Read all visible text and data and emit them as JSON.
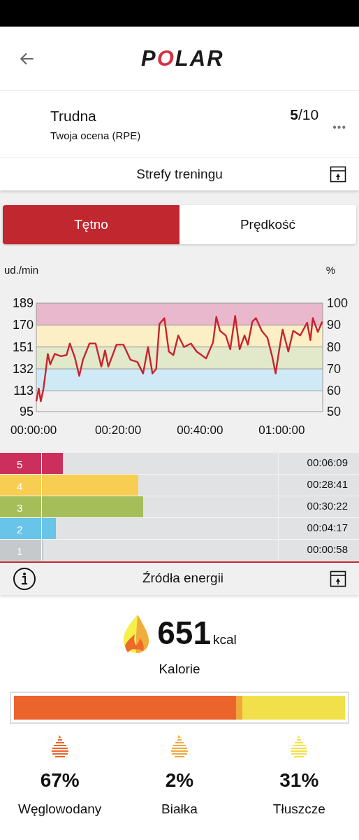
{
  "header": {
    "logo": "POLAR"
  },
  "rpe": {
    "title": "Trudna",
    "subtitle": "Twoja ocena (RPE)",
    "score": "5",
    "max": "/10",
    "menu": "•••"
  },
  "zones_section": {
    "title": "Strefy treningu",
    "tabs": [
      {
        "label": "Tętno",
        "selected": true
      },
      {
        "label": "Prędkość",
        "selected": false
      }
    ],
    "left_unit": "ud./min",
    "right_unit": "%",
    "right_ticks": [
      "100",
      "90",
      "80",
      "70",
      "60",
      "50"
    ],
    "chart_data": {
      "type": "line",
      "x": [
        0,
        0.6,
        1.1,
        1.7,
        2.3,
        2.8,
        3.4,
        4.5,
        6,
        7.4,
        8.2,
        9.4,
        10.5,
        11.4,
        13,
        14.5,
        15.9,
        16.8,
        17.6,
        19.6,
        21.3,
        23,
        24.7,
        26.1,
        27.3,
        28.4,
        29.3,
        30.1,
        31.3,
        32.4,
        33.5,
        34.7,
        36.1,
        37.8,
        39.2,
        41.5,
        43.2,
        44,
        44.9,
        46.3,
        47.4,
        48.6,
        49.7,
        50.9,
        51.7,
        52.8,
        53.7,
        55.1,
        56.5,
        57.7,
        58.5,
        59.4,
        60.2,
        61.6,
        62.8,
        64.5,
        66.2,
        67,
        67.6,
        68.8,
        69.9
      ],
      "series": [
        {
          "color": "#c8232e",
          "values": [
            104,
            115,
            104,
            114,
            130,
            145,
            136,
            145,
            143,
            144,
            154,
            142,
            126,
            140,
            154,
            154,
            134,
            148,
            134,
            153,
            153,
            140,
            138,
            128,
            151,
            128,
            132,
            171,
            176,
            147,
            144,
            161,
            151,
            154,
            147,
            141,
            155,
            177,
            165,
            161,
            149,
            178,
            149,
            161,
            153,
            173,
            176,
            165,
            159,
            142,
            128,
            149,
            166,
            147,
            165,
            161,
            172,
            157,
            176,
            164,
            173
          ]
        }
      ],
      "xlim": [
        0,
        70
      ],
      "ylim": [
        95,
        189
      ],
      "xticks": [
        {
          "value": 0,
          "label": "00:00:00"
        },
        {
          "value": 20,
          "label": "00:20:00"
        },
        {
          "value": 40,
          "label": "00:40:00"
        },
        {
          "value": 60,
          "label": "01:00:00"
        }
      ],
      "yticks": [
        95,
        113,
        132,
        151,
        170,
        189
      ],
      "grid": true,
      "bands": [
        {
          "axis": "y",
          "from": 113,
          "to": 132,
          "color": "#cfeaf6"
        },
        {
          "axis": "y",
          "from": 132,
          "to": 151,
          "color": "#e2e8ca"
        },
        {
          "axis": "y",
          "from": 151,
          "to": 170,
          "color": "#fcefc6"
        },
        {
          "axis": "y",
          "from": 170,
          "to": 189,
          "color": "#e9b8cc"
        }
      ]
    },
    "zones": [
      {
        "label": "5",
        "time": "00:06:09",
        "level": 0.226,
        "color": "#cc2f5c"
      },
      {
        "label": "4",
        "time": "00:28:41",
        "level": 0.497,
        "color": "#f7cd52"
      },
      {
        "label": "3",
        "time": "00:30:22",
        "level": 0.515,
        "color": "#a5be5a"
      },
      {
        "label": "2",
        "time": "00:04:17",
        "level": 0.2,
        "color": "#68c4e8"
      },
      {
        "label": "1",
        "time": "00:00:58",
        "level": 0.156,
        "color": "#c5c9cc"
      }
    ]
  },
  "energy_section": {
    "title": "Źródła energii",
    "calories": "651",
    "unit": "kcal",
    "calories_label": "Kalorie",
    "sources": [
      {
        "percent": "67%",
        "label": "Węglowodany",
        "color": "#eb642c"
      },
      {
        "percent": "2%",
        "label": "Białka",
        "color": "#f0a83c"
      },
      {
        "percent": "31%",
        "label": "Tłuszcze",
        "color": "#f2e04a"
      }
    ]
  }
}
